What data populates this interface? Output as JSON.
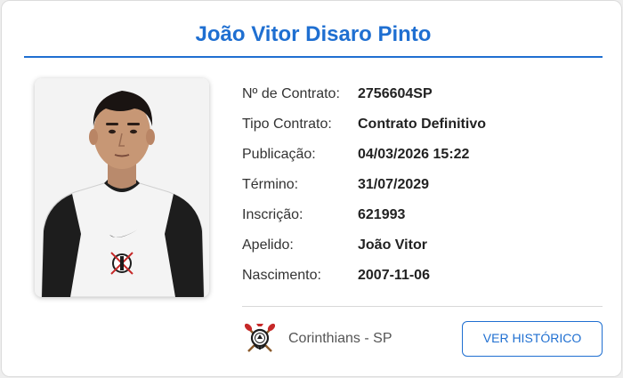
{
  "player": {
    "name": "João Vitor Disaro Pinto"
  },
  "details": [
    {
      "label": "Nº de Contrato:",
      "value": "2756604SP"
    },
    {
      "label": "Tipo Contrato:",
      "value": "Contrato Definitivo"
    },
    {
      "label": "Publicação:",
      "value": "04/03/2026 15:22"
    },
    {
      "label": "Término:",
      "value": "31/07/2029"
    },
    {
      "label": "Inscrição:",
      "value": "621993"
    },
    {
      "label": "Apelido:",
      "value": "João Vitor"
    },
    {
      "label": "Nascimento:",
      "value": "2007-11-06"
    }
  ],
  "club": {
    "name": "Corinthians - SP",
    "logo_icon": "corinthians-crest-icon"
  },
  "actions": {
    "history_label": "VER HISTÓRICO"
  },
  "colors": {
    "accent": "#1f6fd1",
    "card_bg": "#ffffff",
    "page_bg": "#eeeeee"
  }
}
